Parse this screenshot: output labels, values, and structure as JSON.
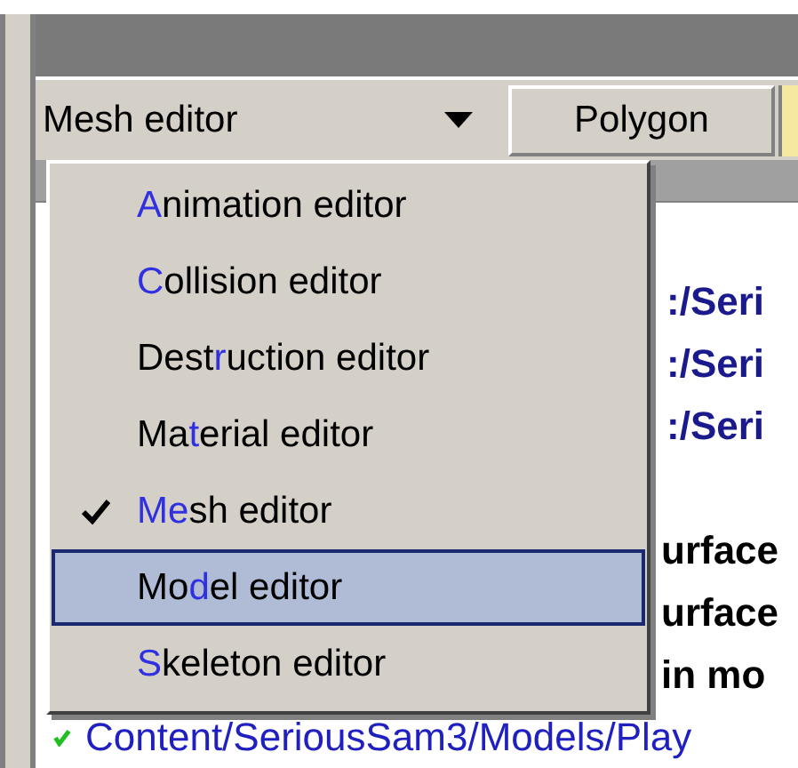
{
  "toolbar": {
    "editor_combo": {
      "value": "Mesh editor",
      "expanded": true
    },
    "polygon_button": {
      "label": "Polygon"
    }
  },
  "list_rows": [
    {
      "text": ":/Seri",
      "kind": "path"
    },
    {
      "text": ":/Seri",
      "kind": "path"
    },
    {
      "text": ":/Seri",
      "kind": "path"
    },
    {
      "kind": "blank"
    },
    {
      "text": "urface",
      "kind": "bold"
    },
    {
      "text": "urface",
      "kind": "bold"
    },
    {
      "text": "in mo",
      "kind": "bold"
    },
    {
      "text": "Content/SeriousSam3/Models/Play",
      "kind": "ok"
    }
  ],
  "editor_menu": [
    {
      "accel": "A",
      "after": "nimation editor",
      "checked": false,
      "selected": false
    },
    {
      "accel": "C",
      "after": "ollision editor",
      "checked": false,
      "selected": false
    },
    {
      "before": "Dest",
      "accel": "r",
      "after": "uction editor",
      "checked": false,
      "selected": false
    },
    {
      "before": "Ma",
      "accel": "t",
      "after": "erial editor",
      "checked": false,
      "selected": false
    },
    {
      "accel": "Me",
      "after": "sh editor",
      "checked": true,
      "selected": false
    },
    {
      "before": "Mo",
      "accel": "d",
      "after": "el editor",
      "checked": false,
      "selected": true
    },
    {
      "accel": "S",
      "after": "keleton editor",
      "checked": false,
      "selected": false
    }
  ]
}
